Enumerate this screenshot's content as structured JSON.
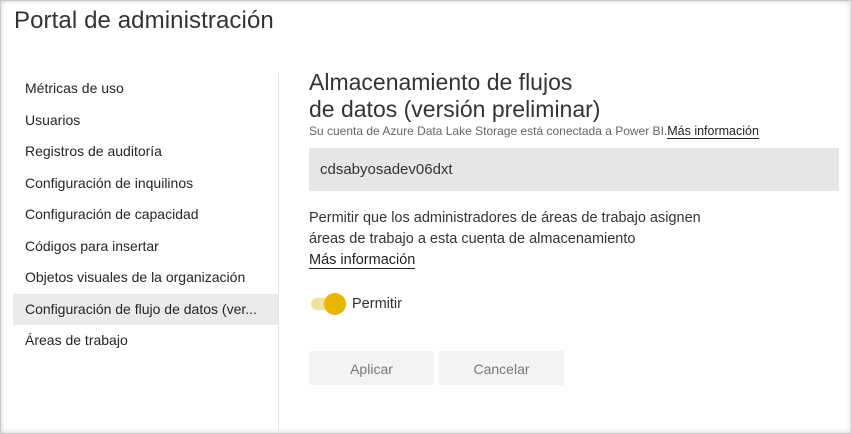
{
  "header": {
    "title": "Portal de administración"
  },
  "sidebar": {
    "items": [
      {
        "label": "Métricas de uso",
        "selected": false
      },
      {
        "label": "Usuarios",
        "selected": false
      },
      {
        "label": "Registros de auditoría",
        "selected": false
      },
      {
        "label": "Configuración de inquilinos",
        "selected": false
      },
      {
        "label": "Configuración de capacidad",
        "selected": false
      },
      {
        "label": "Códigos para insertar",
        "selected": false
      },
      {
        "label": "Objetos visuales de la organización",
        "selected": false
      },
      {
        "label": "Configuración de flujo de datos (ver...",
        "selected": true
      },
      {
        "label": "Áreas de trabajo",
        "selected": false
      }
    ]
  },
  "main": {
    "title_line1": "Almacenamiento de flujos",
    "title_line2": "de datos (versión preliminar)",
    "subtitle": "Su cuenta de Azure Data Lake Storage está conectada a Power BI.",
    "subtitle_link": "Más información",
    "account_name": "cdsabyosadev06dxt",
    "desc_line1": "Permitir que los administradores de áreas de trabajo asignen",
    "desc_line2": "áreas de trabajo a esta cuenta de almacenamiento",
    "desc_link": "Más información",
    "toggle": {
      "label": "Permitir",
      "on": true
    },
    "apply_label": "Aplicar",
    "cancel_label": "Cancelar"
  },
  "colors": {
    "accent": "#e8b600",
    "selected_bg": "#eaeaea",
    "input_bg": "#e6e6e6"
  }
}
